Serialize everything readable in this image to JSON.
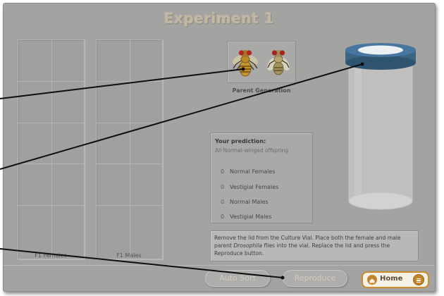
{
  "title": "Experiment 1",
  "grids": {
    "f1_females_label": "F1 Females",
    "f1_males_label": "F1 Males"
  },
  "parent": {
    "label": "Parent Generation",
    "flies": [
      "female-drosophila-icon",
      "male-drosophila-icon"
    ]
  },
  "prediction": {
    "title": "Your prediction:",
    "subtitle": "All Normal-winged offspring",
    "rows": [
      {
        "count": "0",
        "label": "Normal Females"
      },
      {
        "count": "0",
        "label": "Vestigial Females"
      },
      {
        "count": "0",
        "label": "Normal Males"
      },
      {
        "count": "0",
        "label": "Vestigial Males"
      }
    ]
  },
  "instructions": {
    "part1": "Remove the lid from the Culture Vial. Place both the female and male parent ",
    "species": "Drosophila",
    "part2": " flies into the vial. Replace the lid and press the Reproduce button."
  },
  "buttons": {
    "auto_sort": "Auto Sort",
    "reproduce": "Reproduce",
    "home": "Home"
  },
  "icons": {
    "home": "home-icon",
    "menu": "menu-icon",
    "vial": "culture-vial-icon"
  },
  "colors": {
    "panel_bg": "#a3a3a2",
    "home_border": "#c98c26",
    "vial_lid": "#3b6582",
    "fly_body": "#c4962e",
    "fly_eye": "#b5261d"
  }
}
